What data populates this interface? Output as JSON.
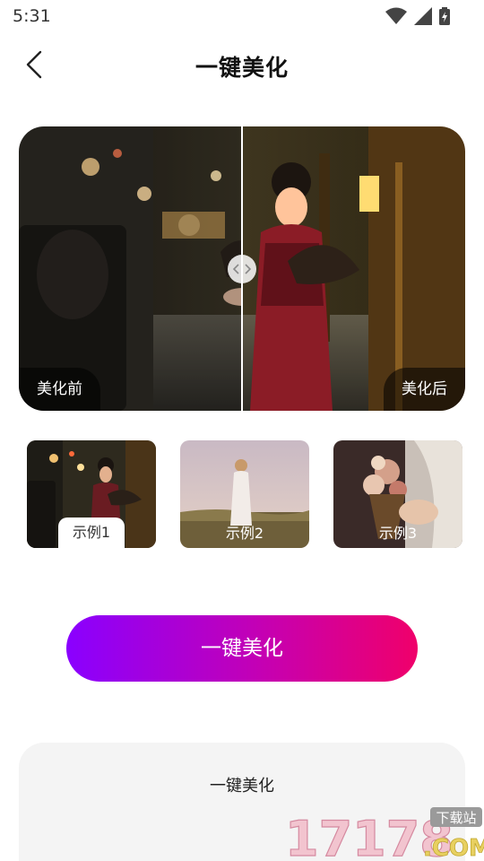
{
  "status_bar": {
    "time": "5:31"
  },
  "header": {
    "title": "一键美化"
  },
  "compare": {
    "before_label": "美化前",
    "after_label": "美化后"
  },
  "examples": [
    {
      "label": "示例1"
    },
    {
      "label": "示例2"
    },
    {
      "label": "示例3"
    }
  ],
  "cta": {
    "label": "一键美化"
  },
  "info": {
    "title": "一键美化"
  },
  "watermark": {
    "number": "17178",
    "badge": "下载站",
    "suffix": ".COM"
  },
  "colors": {
    "gradient_start": "#8a00ff",
    "gradient_end": "#f0006a"
  }
}
